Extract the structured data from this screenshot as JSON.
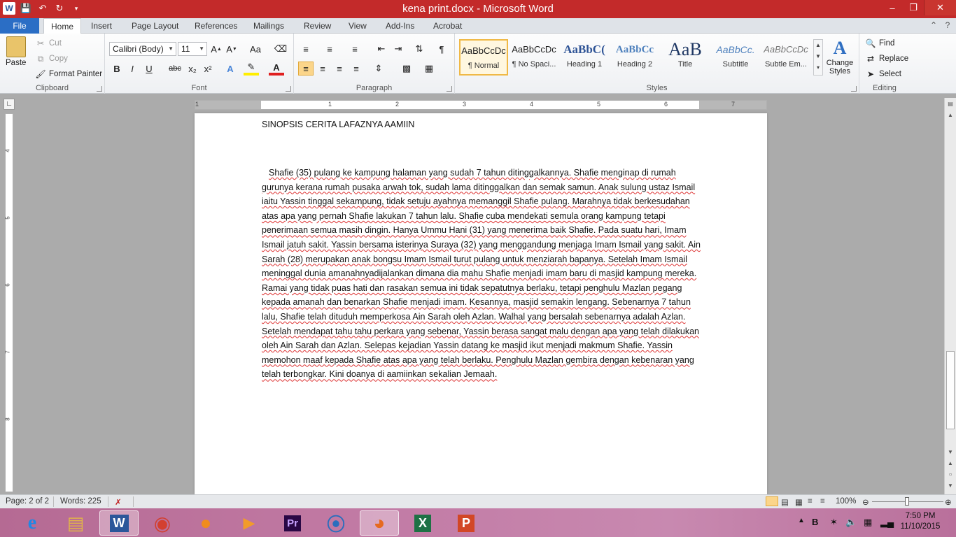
{
  "window": {
    "title": "kena print.docx  -  Microsoft Word",
    "app_letter": "W",
    "minimize": "–",
    "restore": "❐",
    "close": "✕"
  },
  "tabs": [
    {
      "label": "File"
    },
    {
      "label": "Home"
    },
    {
      "label": "Insert"
    },
    {
      "label": "Page Layout"
    },
    {
      "label": "References"
    },
    {
      "label": "Mailings"
    },
    {
      "label": "Review"
    },
    {
      "label": "View"
    },
    {
      "label": "Add-Ins"
    },
    {
      "label": "Acrobat"
    }
  ],
  "ribbon": {
    "clipboard": {
      "label": "Clipboard",
      "paste": "Paste",
      "cut": "Cut",
      "copy": "Copy",
      "format_painter": "Format Painter"
    },
    "font": {
      "label": "Font",
      "family": "Calibri (Body)",
      "size": "11",
      "bold": "B",
      "italic": "I",
      "underline": "U",
      "strike": "abc",
      "subscript": "x₂",
      "superscript": "x²",
      "change_case": "Aa"
    },
    "paragraph": {
      "label": "Paragraph"
    },
    "styles": {
      "label": "Styles",
      "items": [
        {
          "sample": "AaBbCcDc",
          "name": "¶ Normal"
        },
        {
          "sample": "AaBbCcDc",
          "name": "¶ No Spaci..."
        },
        {
          "sample": "AaBbC(",
          "name": "Heading 1"
        },
        {
          "sample": "AaBbCc",
          "name": "Heading 2"
        },
        {
          "sample": "AaB",
          "name": "Title"
        },
        {
          "sample": "AaBbCc.",
          "name": "Subtitle"
        },
        {
          "sample": "AaBbCcDc",
          "name": "Subtle Em..."
        }
      ],
      "change_styles": "Change Styles"
    },
    "editing": {
      "label": "Editing",
      "find": "Find",
      "replace": "Replace",
      "select": "Select"
    }
  },
  "ruler": {
    "h_ticks": [
      "1",
      "1",
      "2",
      "3",
      "4",
      "5",
      "6",
      "7"
    ],
    "v_ticks": [
      "4",
      "5",
      "6",
      "7",
      "8"
    ]
  },
  "document": {
    "heading": "SINOPSIS CERITA LAFAZNYA AAMIIN",
    "body": "Shafie (35) pulang ke kampung halaman yang sudah 7 tahun ditinggalkannya. Shafie menginap di rumah gurunya kerana rumah pusaka arwah tok, sudah lama ditinggalkan dan semak samun. Anak sulung ustaz Ismail iaitu Yassin tinggal sekampung, tidak setuju ayahnya memanggil Shafie pulang. Marahnya tidak berkesudahan atas apa yang pernah Shafie lakukan 7 tahun lalu.  Shafie cuba mendekati semula orang kampung tetapi penerimaan semua masih dingin. Hanya Ummu Hani (31) yang menerima baik Shafie. Pada suatu hari, Imam Ismail jatuh sakit. Yassin bersama isterinya Suraya (32) yang menggandung menjaga Imam Ismail yang sakit. Ain Sarah (28) merupakan anak bongsu Imam Ismail turut pulang untuk menziarah bapanya. Setelah Imam Ismail meninggal dunia amanahnyadijalankan dimana dia mahu Shafie menjadi imam baru di masjid kampung mereka. Ramai yang tidak puas hati dan rasakan semua ini tidak sepatutnya berlaku, tetapi penghulu Mazlan pegang kepada amanah dan benarkan Shafie menjadi imam. Kesannya, masjid semakin lengang. Sebenarnya 7 tahun lalu, Shafie telah dituduh memperkosa Ain Sarah oleh Azlan. Walhal yang bersalah sebenarnya adalah Azlan. Setelah mendapat tahu tahu perkara yang sebenar, Yassin berasa sangat malu dengan apa yang telah dilakukan oleh Ain Sarah dan Azlan. Selepas kejadian Yassin datang ke masjid ikut menjadi makmum Shafie. Yassin memohon maaf kepada Shafie atas apa yang telah berlaku. Penghulu Mazlan gembira dengan kebenaran yang telah terbongkar. Kini doanya di aamiinkan sekalian Jemaah."
  },
  "status": {
    "page": "Page: 2 of 2",
    "words": "Words: 225",
    "zoom": "100%"
  },
  "taskbar": {
    "apps": [
      {
        "name": "internet-explorer",
        "glyph": "e",
        "color": "#1e88e5"
      },
      {
        "name": "file-explorer",
        "glyph": "▤",
        "color": "#e0b34a"
      },
      {
        "name": "word",
        "glyph": "W",
        "color": "#2b579a"
      },
      {
        "name": "chrome",
        "glyph": "◉",
        "color": "#d33f2f"
      },
      {
        "name": "app-orange",
        "glyph": "●",
        "color": "#f08c1e"
      },
      {
        "name": "media-player",
        "glyph": "▶",
        "color": "#f29b2a"
      },
      {
        "name": "premiere",
        "glyph": "Pr",
        "color": "#c8a2ff"
      },
      {
        "name": "app-blue",
        "glyph": "⦿",
        "color": "#2a6ebd"
      },
      {
        "name": "firefox",
        "glyph": "◕",
        "color": "#e66a1f"
      },
      {
        "name": "excel",
        "glyph": "X",
        "color": "#1e7145"
      },
      {
        "name": "powerpoint",
        "glyph": "P",
        "color": "#d24726"
      }
    ],
    "time": "7:50 PM",
    "date": "11/10/2015"
  }
}
